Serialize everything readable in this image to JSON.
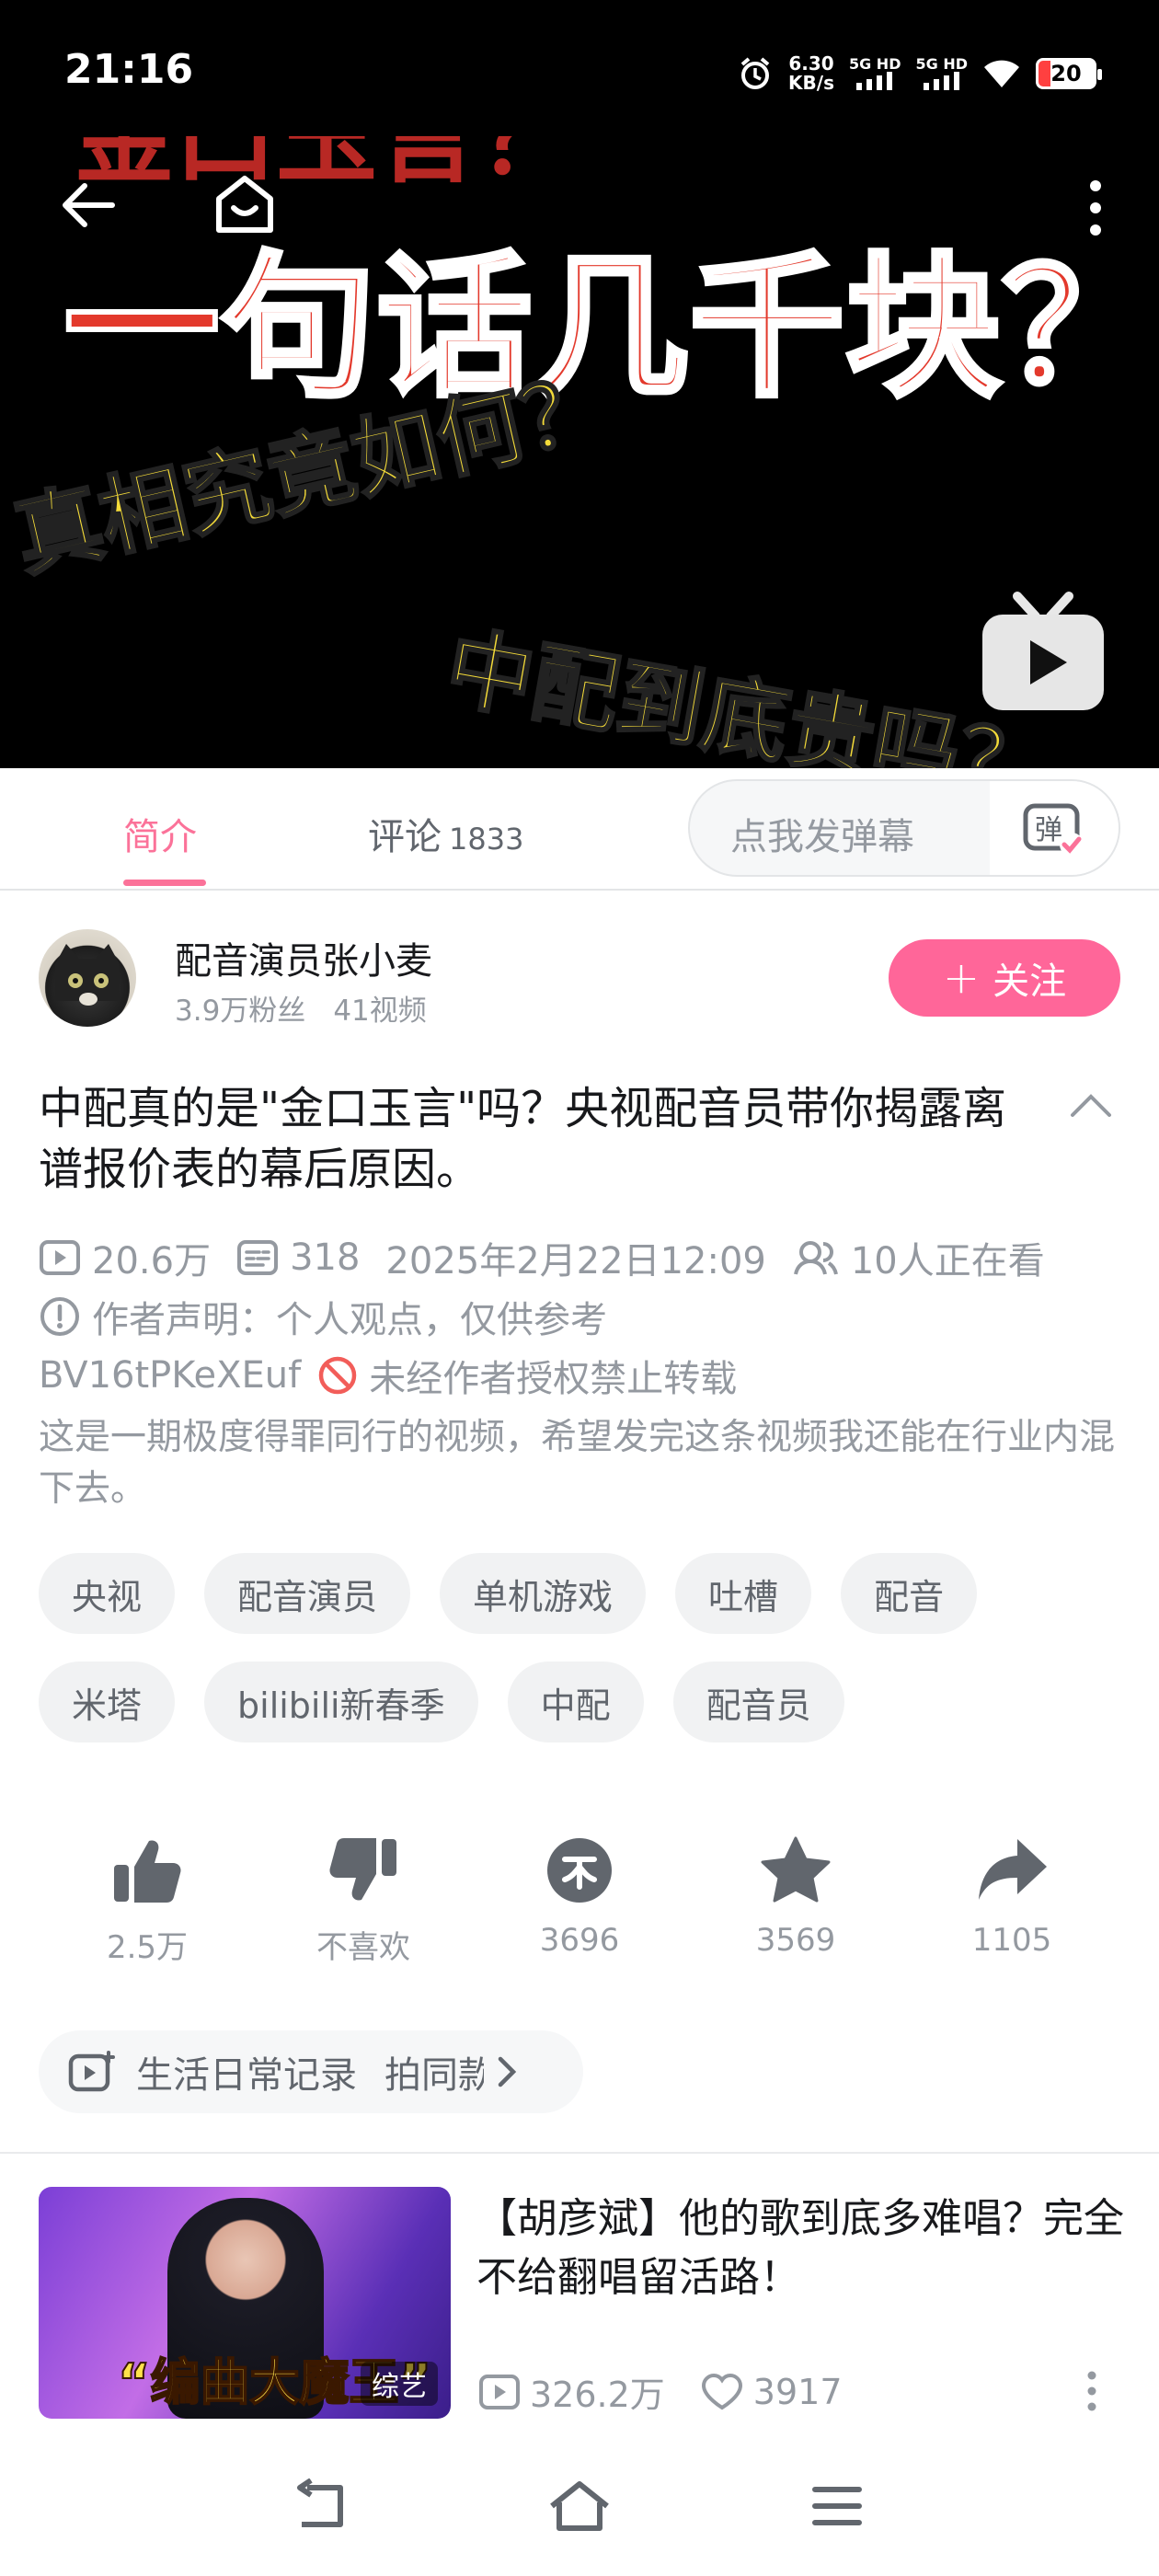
{
  "status_bar": {
    "time": "21:16",
    "net_speed_value": "6.30",
    "net_speed_unit": "KB/s",
    "signal1": "5G HD",
    "signal2": "5G HD",
    "battery": "20"
  },
  "video": {
    "cover_line_top": "金口玉言？",
    "cover_line_main": "一句话几千块？",
    "cover_line_yellow1": "真相究竟如何？",
    "cover_line_yellow2": "中配到底贵吗？"
  },
  "tabs": {
    "intro": "简介",
    "comments": "评论",
    "comments_count": "1833",
    "danmaku_placeholder": "点我发弹幕"
  },
  "uploader": {
    "name": "配音演员张小麦",
    "fans": "3.9万粉丝",
    "videos": "41视频",
    "follow_label": "关注"
  },
  "video_info": {
    "title": "中配真的是\"金口玉言\"吗？央视配音员带你揭露离谱报价表的幕后原因。",
    "views": "20.6万",
    "danmaku_count": "318",
    "published": "2025年2月22日12:09",
    "watching": "10人正在看",
    "author_statement": "作者声明：个人观点，仅供参考",
    "bvid": "BV16tPKeXEuf",
    "no_repost": "未经作者授权禁止转载",
    "description": "这是一期极度得罪同行的视频，希望发完这条视频我还能在行业内混下去。"
  },
  "tags": [
    "央视",
    "配音演员",
    "单机游戏",
    "吐槽",
    "配音",
    "米塔",
    "bilibili新春季",
    "中配",
    "配音员"
  ],
  "actions": {
    "like": "2.5万",
    "dislike": "不喜欢",
    "coin": "3696",
    "favorite": "3569",
    "share": "1105"
  },
  "topic": {
    "label": "生活日常记录",
    "secondary": "拍同款"
  },
  "recommended": {
    "thumb_caption": "“编曲大魔王”",
    "thumb_badge": "综艺",
    "title": "【胡彦斌】他的歌到底多难唱？完全不给翻唱留活路！",
    "views": "326.2万",
    "likes": "3917"
  },
  "colors": {
    "accent_pink": "#fb7299",
    "follow_pink": "#ff6699",
    "text_gray": "#9499a0",
    "icon_gray": "#61666d"
  }
}
